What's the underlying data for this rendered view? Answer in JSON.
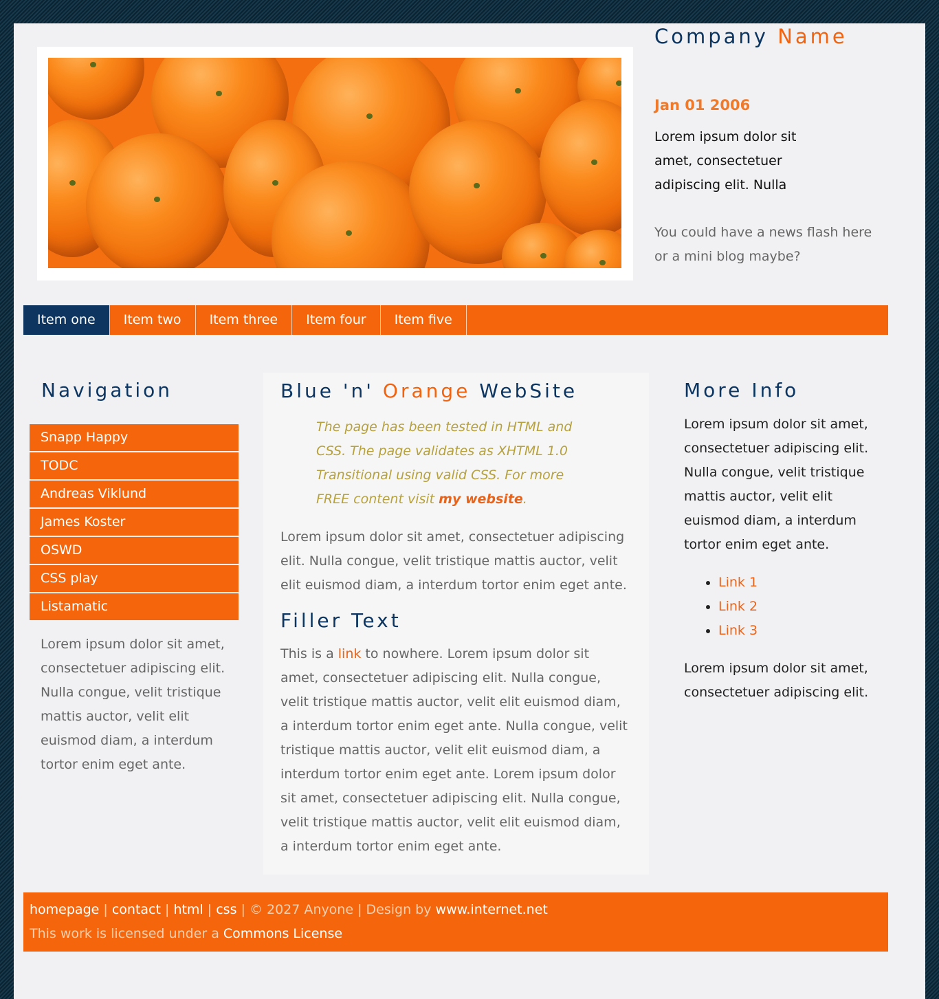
{
  "header": {
    "company_first": "Company",
    "company_accent": "Name",
    "hero_image_alt": "oranges-photo"
  },
  "news": {
    "date": "Jan 01 2006",
    "text": "Lorem ipsum dolor sit amet, consectetuer adipiscing elit. Nulla",
    "flash": "You could have a news flash here or a mini blog maybe?"
  },
  "topnav": {
    "items": [
      {
        "label": "Item one",
        "active": true
      },
      {
        "label": "Item two",
        "active": false
      },
      {
        "label": "Item three",
        "active": false
      },
      {
        "label": "Item four",
        "active": false
      },
      {
        "label": "Item five",
        "active": false
      }
    ]
  },
  "sidebar": {
    "title": "Navigation",
    "items": [
      {
        "label": "Snapp Happy"
      },
      {
        "label": "TODC"
      },
      {
        "label": "Andreas Viklund"
      },
      {
        "label": "James Koster"
      },
      {
        "label": "OSWD"
      },
      {
        "label": "CSS play"
      },
      {
        "label": "Listamatic"
      }
    ],
    "text": "Lorem ipsum dolor sit amet, consectetuer adipiscing elit. Nulla congue, velit tristique mattis auctor, velit elit euismod diam, a interdum tortor enim eget ante."
  },
  "main": {
    "title_part1": "Blue 'n'",
    "title_accent": "Orange",
    "title_part2": "WebSite",
    "quote_text": "The page has been tested in  HTML and CSS. The page validates as XHTML 1.0 Transitional using valid CSS. For more FREE content visit ",
    "quote_link": "my website",
    "quote_end": ".",
    "paragraph": "Lorem ipsum dolor sit amet, consectetuer adipiscing elit. Nulla congue, velit tristique mattis auctor, velit elit euismod diam, a interdum tortor enim eget ante.",
    "filler_title": "Filler Text",
    "filler_start": "This is a ",
    "filler_link": "link",
    "filler_rest": " to nowhere. Lorem ipsum dolor sit amet, consectetuer adipiscing elit. Nulla congue, velit tristique mattis auctor, velit elit euismod diam, a interdum tortor enim eget ante. Nulla congue, velit tristique mattis auctor, velit elit euismod diam, a interdum tortor enim eget ante. Lorem ipsum dolor sit amet, consectetuer adipiscing elit. Nulla congue, velit tristique mattis auctor, velit elit euismod diam, a interdum tortor enim eget ante."
  },
  "more_info": {
    "title": "More Info",
    "paragraph": "Lorem ipsum dolor sit amet, consectetuer adipiscing elit. Nulla congue, velit tristique mattis auctor, velit elit euismod diam, a interdum tortor enim eget ante.",
    "links": [
      {
        "label": "Link 1"
      },
      {
        "label": "Link 2"
      },
      {
        "label": "Link 3"
      }
    ],
    "paragraph2": "Lorem ipsum dolor sit amet, consectetuer adipiscing elit."
  },
  "footer": {
    "links": [
      "homepage",
      "contact",
      "html",
      "css"
    ],
    "separator": "|",
    "copyright": "© 2027 Anyone",
    "design_by_text": "Design by",
    "design_by_link": "www.internet.net",
    "license_text": "This work is licensed under a",
    "license_link": "Commons License"
  },
  "colors": {
    "navy": "#0c3661",
    "orange": "#f5650c",
    "page_bg": "#f1f1f3",
    "quote_olive": "#b6a13c"
  }
}
